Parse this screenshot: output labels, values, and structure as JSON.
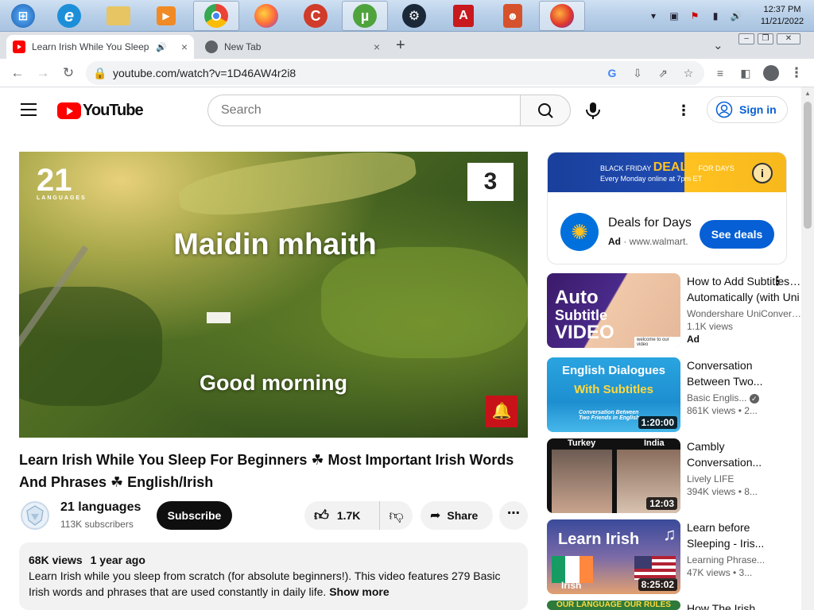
{
  "taskbar": {
    "apps": [
      {
        "name": "windows-start",
        "color": "#2a6dc0",
        "glyph": "⊞"
      },
      {
        "name": "internet-explorer",
        "color": "#1c8fd8",
        "glyph": "e"
      },
      {
        "name": "file-explorer",
        "color": "#d9b548",
        "glyph": "▭"
      },
      {
        "name": "media-player",
        "color": "#e07a1b",
        "glyph": "▶"
      },
      {
        "name": "chrome",
        "color": "#34a853",
        "glyph": "◉"
      },
      {
        "name": "firefox",
        "color": "#ff7139",
        "glyph": "◐"
      },
      {
        "name": "ccleaner",
        "color": "#d03b2a",
        "glyph": "C"
      },
      {
        "name": "utorrent",
        "color": "#4fa33d",
        "glyph": "µ"
      },
      {
        "name": "steam",
        "color": "#1b2838",
        "glyph": "⚙"
      },
      {
        "name": "pdf-reader",
        "color": "#c8191e",
        "glyph": "A"
      },
      {
        "name": "game-app",
        "color": "#d6522c",
        "glyph": "☻"
      },
      {
        "name": "firefox-nightly",
        "color": "#e0392b",
        "glyph": "◐"
      }
    ],
    "clock_time": "12:37 PM",
    "clock_date": "11/21/2022"
  },
  "tabs": [
    {
      "title": "Learn Irish While You Sleep F",
      "audio": "🔊",
      "close": "×"
    },
    {
      "title": "New Tab",
      "close": "×"
    }
  ],
  "new_tab_symbol": "+",
  "tab_menu_symbol": "⌄",
  "url": "youtube.com/watch?v=1D46AW4r2i8",
  "youtube": {
    "logo_text": "YouTube",
    "search_placeholder": "Search",
    "sign_in": "Sign in"
  },
  "player": {
    "channel_watermark": "21",
    "channel_watermark_sub": "LANGUAGES",
    "counter": "3",
    "irish_phrase": "Maidin mhaith",
    "english_phrase": "Good morning"
  },
  "video": {
    "title": "Learn Irish While You Sleep For Beginners ☘ Most Important Irish Words And Phrases ☘ English/Irish",
    "channel": "21 languages",
    "subscribers": "113K subscribers",
    "subscribe_label": "Subscribe",
    "likes": "1.7K",
    "share_label": "Share",
    "views": "68K views",
    "age": "1 year ago",
    "description": "Learn Irish while you sleep from scratch (for absolute beginners!). This video features 279 Basic Irish words and phrases that are used constantly in daily life. ",
    "show_more": "Show more"
  },
  "ad": {
    "banner_line1": "BLACK FRIDAY",
    "banner_deals": "DEALS",
    "banner_for_days": "FOR DAYS",
    "banner_line2": "Every Monday online at 7pm ET",
    "title": "Deals for Days",
    "ad_label": "Ad",
    "domain": "www.walmart.",
    "cta": "See deals"
  },
  "recommendations": [
    {
      "title1": "How to Add Subtitles to",
      "title2": "Automatically (with Uni",
      "channel": "Wondershare UniConverter",
      "views": "1.1K views",
      "ad": "Ad",
      "thumb_text1": "Auto",
      "thumb_text2": "Subtitle",
      "thumb_text3": "VIDEO",
      "thumb_small": "welcome to our video"
    },
    {
      "title1": "Conversation",
      "title2": "Between Two...",
      "channel": "Basic Englis...",
      "views": "861K views • 2...",
      "duration": "1:20:00",
      "thumb_text1": "English Dialogues",
      "thumb_text2": "With Subtitles",
      "thumb_small": "Conversation Between Two Friends in English"
    },
    {
      "title1": "Cambly",
      "title2": "Conversation...",
      "channel": "Lively LIFE",
      "views": "394K views • 8...",
      "duration": "12:03",
      "thumb_left": "Turkey",
      "thumb_right": "India"
    },
    {
      "title1": "Learn before",
      "title2": "Sleeping - Iris...",
      "channel": "Learning Phrase...",
      "views": "47K views • 3...",
      "duration": "8:25:02",
      "thumb_text1": "Learn Irish",
      "thumb_small": "Irish"
    },
    {
      "title1": "How The Irish",
      "title2": "",
      "channel": "",
      "views": "",
      "thumb_text1": "OUR LANGUAGE OUR RULES"
    }
  ]
}
